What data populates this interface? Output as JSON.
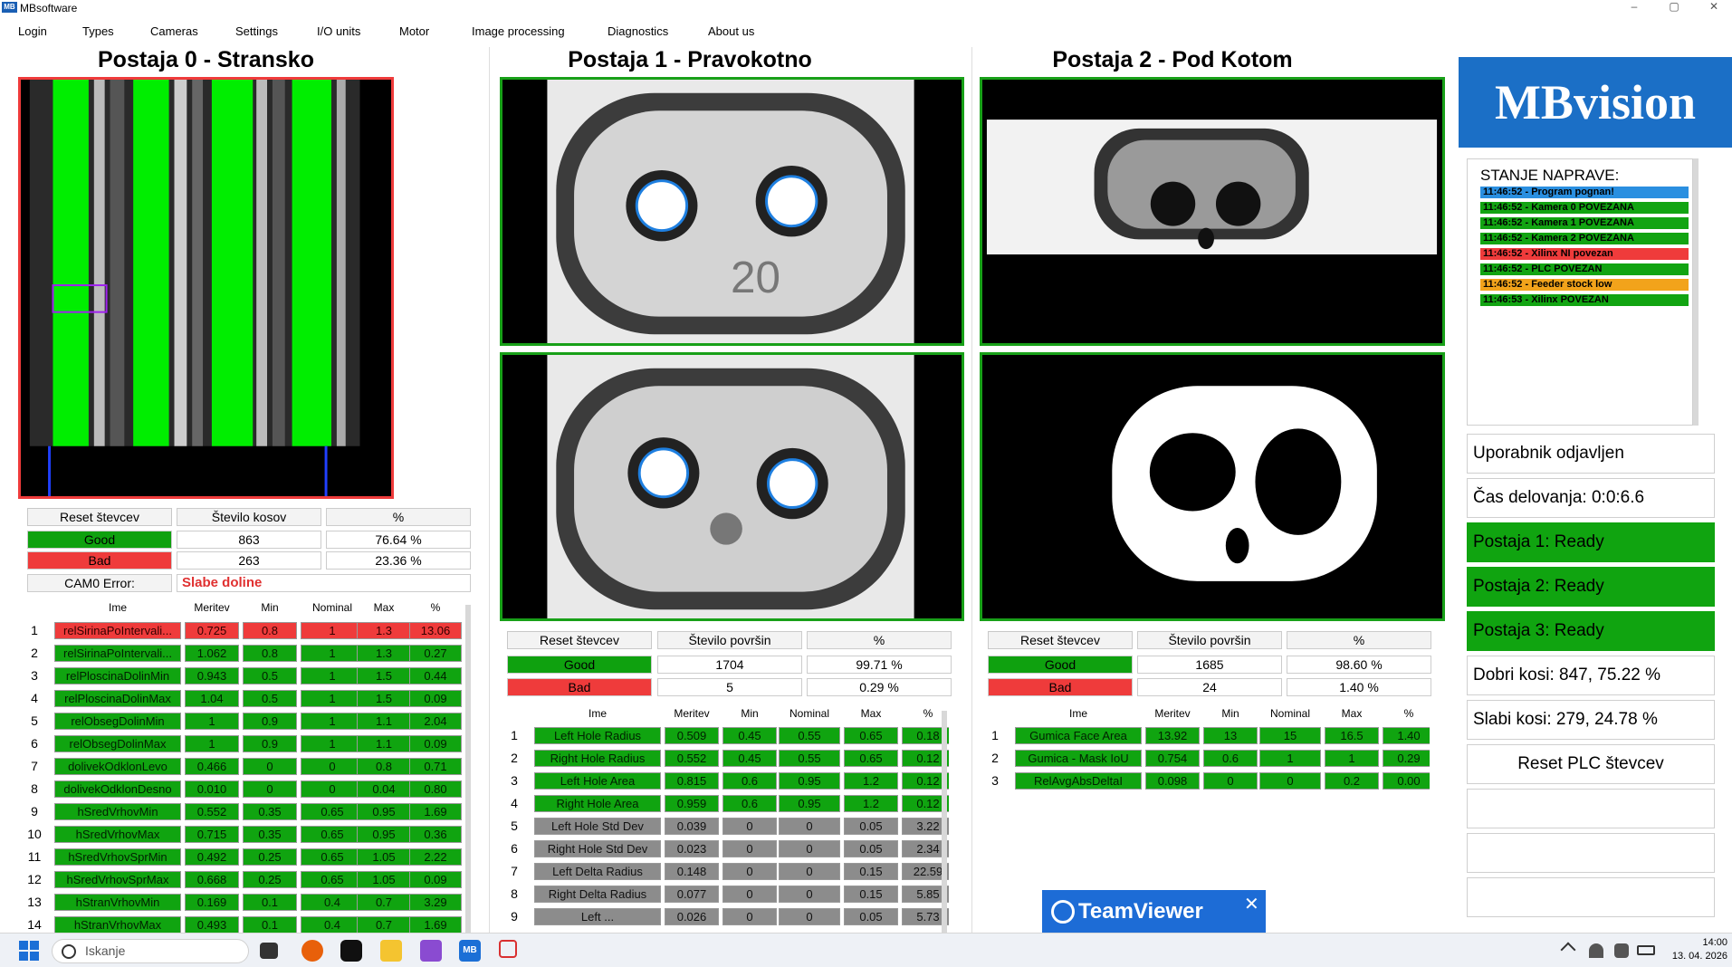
{
  "app": {
    "title": "MBsoftware",
    "logo": "MB",
    "minimize": "–",
    "maximize": "▢",
    "close": "✕"
  },
  "menu": [
    "Login",
    "Types",
    "Cameras",
    "Settings",
    "I/O units",
    "Motor",
    "Image processing",
    "Diagnostics",
    "About us"
  ],
  "stations": [
    {
      "title": "Postaja 0 - Stransko",
      "counters": {
        "reset": "Reset števcev",
        "count_label": "Število kosov",
        "pct_label": "%",
        "good": "Good",
        "good_count": "863",
        "good_pct": "76.64 %",
        "bad": "Bad",
        "bad_count": "263",
        "bad_pct": "23.36 %",
        "error_label": "CAM0 Error:",
        "error_value": "Slabe doline"
      },
      "headers": [
        "Ime",
        "Meritev",
        "Min",
        "Nominal",
        "Max",
        "%"
      ],
      "rows": [
        [
          "1",
          "relSirinaPoIntervali...",
          "0.725",
          "0.8",
          "1",
          "1.3",
          "13.06",
          "r"
        ],
        [
          "2",
          "relSirinaPoIntervali...",
          "1.062",
          "0.8",
          "1",
          "1.3",
          "0.27",
          "g"
        ],
        [
          "3",
          "relPloscinaDolinMin",
          "0.943",
          "0.5",
          "1",
          "1.5",
          "0.44",
          "g"
        ],
        [
          "4",
          "relPloscinaDolinMax",
          "1.04",
          "0.5",
          "1",
          "1.5",
          "0.09",
          "g"
        ],
        [
          "5",
          "relObsegDolinMin",
          "1",
          "0.9",
          "1",
          "1.1",
          "2.04",
          "g"
        ],
        [
          "6",
          "relObsegDolinMax",
          "1",
          "0.9",
          "1",
          "1.1",
          "0.09",
          "g"
        ],
        [
          "7",
          "dolivekOdklonLevo",
          "0.466",
          "0",
          "0",
          "0.8",
          "0.71",
          "g"
        ],
        [
          "8",
          "dolivekOdklonDesno",
          "0.010",
          "0",
          "0",
          "0.04",
          "0.80",
          "g"
        ],
        [
          "9",
          "hSredVrhovMin",
          "0.552",
          "0.35",
          "0.65",
          "0.95",
          "1.69",
          "g"
        ],
        [
          "10",
          "hSredVrhovMax",
          "0.715",
          "0.35",
          "0.65",
          "0.95",
          "0.36",
          "g"
        ],
        [
          "11",
          "hSredVrhovSprMin",
          "0.492",
          "0.25",
          "0.65",
          "1.05",
          "2.22",
          "g"
        ],
        [
          "12",
          "hSredVrhovSprMax",
          "0.668",
          "0.25",
          "0.65",
          "1.05",
          "0.09",
          "g"
        ],
        [
          "13",
          "hStranVrhovMin",
          "0.169",
          "0.1",
          "0.4",
          "0.7",
          "3.29",
          "g"
        ],
        [
          "14",
          "hStranVrhovMax",
          "0.493",
          "0.1",
          "0.4",
          "0.7",
          "1.69",
          "g"
        ]
      ]
    },
    {
      "title": "Postaja 1 - Pravokotno",
      "image_text": "20",
      "counters": {
        "reset": "Reset števcev",
        "count_label": "Število površin",
        "pct_label": "%",
        "good": "Good",
        "good_count": "1704",
        "good_pct": "99.71 %",
        "bad": "Bad",
        "bad_count": "5",
        "bad_pct": "0.29 %"
      },
      "headers": [
        "Ime",
        "Meritev",
        "Min",
        "Nominal",
        "Max",
        "%"
      ],
      "rows": [
        [
          "1",
          "Left Hole Radius",
          "0.509",
          "0.45",
          "0.55",
          "0.65",
          "0.18",
          "g"
        ],
        [
          "2",
          "Right Hole Radius",
          "0.552",
          "0.45",
          "0.55",
          "0.65",
          "0.12",
          "g"
        ],
        [
          "3",
          "Left Hole Area",
          "0.815",
          "0.6",
          "0.95",
          "1.2",
          "0.12",
          "g"
        ],
        [
          "4",
          "Right Hole Area",
          "0.959",
          "0.6",
          "0.95",
          "1.2",
          "0.12",
          "g"
        ],
        [
          "5",
          "Left Hole Std Dev",
          "0.039",
          "0",
          "0",
          "0.05",
          "3.22",
          "y"
        ],
        [
          "6",
          "Right Hole Std Dev",
          "0.023",
          "0",
          "0",
          "0.05",
          "2.34",
          "y"
        ],
        [
          "7",
          "Left Delta Radius",
          "0.148",
          "0",
          "0",
          "0.15",
          "22.59",
          "y"
        ],
        [
          "8",
          "Right Delta Radius",
          "0.077",
          "0",
          "0",
          "0.15",
          "5.85",
          "y"
        ],
        [
          "9",
          "Left ...",
          "0.026",
          "0",
          "0",
          "0.05",
          "5.73",
          "y"
        ]
      ]
    },
    {
      "title": "Postaja 2 - Pod Kotom",
      "counters": {
        "reset": "Reset števcev",
        "count_label": "Število površin",
        "pct_label": "%",
        "good": "Good",
        "good_count": "1685",
        "good_pct": "98.60 %",
        "bad": "Bad",
        "bad_count": "24",
        "bad_pct": "1.40 %"
      },
      "headers": [
        "Ime",
        "Meritev",
        "Min",
        "Nominal",
        "Max",
        "%"
      ],
      "rows": [
        [
          "1",
          "Gumica Face Area",
          "13.92",
          "13",
          "15",
          "16.5",
          "1.40",
          "g"
        ],
        [
          "2",
          "Gumica - Mask IoU",
          "0.754",
          "0.6",
          "1",
          "1",
          "0.29",
          "g"
        ],
        [
          "3",
          "RelAvgAbsDeltaI",
          "0.098",
          "0",
          "0",
          "0.2",
          "0.00",
          "g"
        ]
      ]
    }
  ],
  "right": {
    "brand": "MBvision",
    "status_header": "STANJE NAPRAVE:",
    "log": [
      {
        "text": "11:46:52 - Program pognan!",
        "color": "#2a8fe0"
      },
      {
        "text": "11:46:52 - Kamera 0 POVEZANA",
        "color": "#12a412"
      },
      {
        "text": "11:46:52 - Kamera 1 POVEZANA",
        "color": "#12a412"
      },
      {
        "text": "11:46:52 - Kamera 2 POVEZANA",
        "color": "#12a412"
      },
      {
        "text": "11:46:52 - Xilinx NI povezan",
        "color": "#ef3b3b"
      },
      {
        "text": "11:46:52 - PLC POVEZAN",
        "color": "#12a412"
      },
      {
        "text": "11:46:52 - Feeder stock low",
        "color": "#f2a31b"
      },
      {
        "text": "11:46:53 - Xilinx POVEZAN",
        "color": "#12a412"
      }
    ],
    "user": "Uporabnik odjavljen",
    "runtime": "Čas delovanja: 0:0:6.6",
    "p1": "Postaja 1: Ready",
    "p2": "Postaja 2: Ready",
    "p3": "Postaja 3: Ready",
    "good": "Dobri kosi: 847, 75.22 %",
    "bad": "Slabi kosi: 279, 24.78 %",
    "reset_plc": "Reset PLC števcev"
  },
  "teamviewer": {
    "label": "TeamViewer",
    "close": "✕"
  },
  "taskbar": {
    "search": "Iskanje",
    "time": "14:00",
    "date": "13. 04. 2026",
    "mb": "MB"
  }
}
